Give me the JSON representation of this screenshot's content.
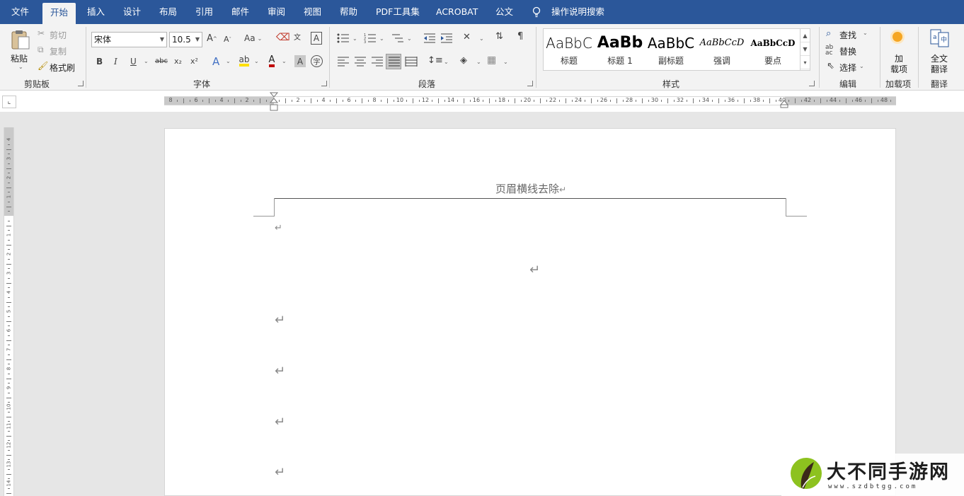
{
  "menu": {
    "tabs": [
      "文件",
      "开始",
      "插入",
      "设计",
      "布局",
      "引用",
      "邮件",
      "审阅",
      "视图",
      "帮助",
      "PDF工具集",
      "ACROBAT",
      "公文"
    ],
    "active_tab": "开始",
    "tell_me": "操作说明搜索"
  },
  "clipboard": {
    "paste": "粘贴",
    "cut": "剪切",
    "copy": "复制",
    "format_painter": "格式刷",
    "group": "剪贴板"
  },
  "font": {
    "name": "宋体",
    "size": "10.5",
    "group": "字体",
    "bold": "B",
    "italic": "I",
    "underline": "U",
    "strike": "abc",
    "subscript": "x₂",
    "superscript": "x²",
    "change_case": "Aa",
    "font_color": "#c00000",
    "highlight_color": "#ffe000"
  },
  "paragraph": {
    "group": "段落"
  },
  "styles": {
    "group": "样式",
    "items": [
      {
        "sample": "AaBbC",
        "name": "标题"
      },
      {
        "sample": "AaBb",
        "name": "标题 1"
      },
      {
        "sample": "AaBbC",
        "name": "副标题"
      },
      {
        "sample": "AaBbCcD",
        "name": "强调"
      },
      {
        "sample": "AaBbCcD",
        "name": "要点"
      }
    ]
  },
  "editing": {
    "find": "查找",
    "replace": "替换",
    "select": "选择",
    "group": "编辑"
  },
  "addins": {
    "label_line1": "加",
    "label_line2": "载项",
    "group": "加载项"
  },
  "translate": {
    "label_line1": "全文",
    "label_line2": "翻译",
    "group": "翻译"
  },
  "ruler": {
    "h_labels": [
      "8",
      "6",
      "4",
      "2",
      "",
      "2",
      "4",
      "6",
      "8",
      "10",
      "12",
      "14",
      "16",
      "18",
      "20",
      "22",
      "24",
      "26",
      "28",
      "30",
      "32",
      "34",
      "36",
      "38",
      "40",
      "42",
      "44",
      "46",
      "48"
    ],
    "v_labels": [
      "4",
      "3",
      "2",
      "1",
      "",
      "1",
      "2",
      "3",
      "4",
      "5",
      "6",
      "7",
      "8",
      "9",
      "10",
      "11",
      "12",
      "13",
      "14"
    ]
  },
  "document": {
    "header_text": "页眉横线去除",
    "paragraph_mark": "↵"
  },
  "watermark": {
    "title": "大不同手游网",
    "url": "www.szdbtgg.com"
  },
  "colors": {
    "accent": "#2b579a",
    "ribbon_bg": "#f3f3f3",
    "page_bg": "#ffffff",
    "canvas_bg": "#e6e6e6"
  }
}
